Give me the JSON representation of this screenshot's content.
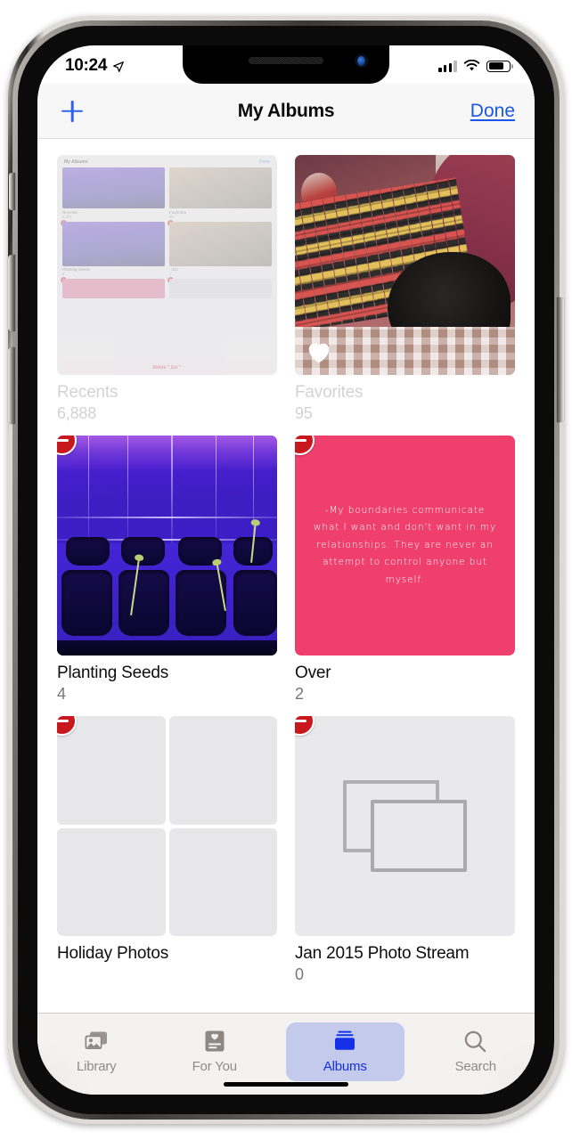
{
  "status_bar": {
    "time": "10:24",
    "location_icon": "location-arrow-icon",
    "signal_icon": "cellular-signal-icon",
    "signal_bars_filled": 3,
    "signal_bars_total": 4,
    "wifi_icon": "wifi-icon",
    "battery_icon": "battery-icon",
    "battery_level_percent": 64
  },
  "navbar": {
    "add_label": "",
    "add_icon": "plus-icon",
    "title": "My Albums",
    "done_label": "Done",
    "accent_color": "#1a57e8"
  },
  "albums": [
    {
      "name": "Recents",
      "count": "6,888",
      "deletable": false,
      "dimmed": true,
      "art": "recursive-screenshot",
      "nested": {
        "title": "My Albums",
        "done_label": "Done",
        "items": [
          {
            "name": "Recents",
            "count": "6,883"
          },
          {
            "name": "Favorites",
            "count": "95"
          },
          {
            "name": "Planting Seeds",
            "count": "4"
          },
          {
            "name": ". Zzz",
            "count": "1"
          }
        ],
        "sheet_label": "Delete \" Zzz \""
      }
    },
    {
      "name": "Favorites",
      "count": "95",
      "deletable": false,
      "dimmed": true,
      "art": "photo-blanket-dog",
      "overlay_icon": "heart-icon"
    },
    {
      "name": "Planting Seeds",
      "count": "4",
      "deletable": true,
      "dimmed": false,
      "art": "photo-uv-seedling-tray"
    },
    {
      "name": "Over",
      "count": "2",
      "deletable": true,
      "dimmed": false,
      "art": "pink-quote-card",
      "quote": "-My boundaries communicate what I want and don't want in my relationships. They are never an attempt to control anyone but myself.",
      "quote_bg_color": "#ef3f6d"
    },
    {
      "name": "Holiday Photos",
      "count": "",
      "deletable": true,
      "dimmed": false,
      "art": "empty-quad-placeholder"
    },
    {
      "name": "Jan 2015 Photo Stream",
      "count": "0",
      "deletable": true,
      "dimmed": false,
      "art": "photo-stream-placeholder-icon"
    }
  ],
  "delete_badge": {
    "icon": "minus-circle-icon",
    "color": "#c8181e"
  },
  "tabbar": {
    "active": "Albums",
    "active_color": "#1330e4",
    "items": [
      {
        "label": "Library",
        "icon": "photos-library-icon"
      },
      {
        "label": "For You",
        "icon": "for-you-heart-card-icon"
      },
      {
        "label": "Albums",
        "icon": "albums-stack-icon"
      },
      {
        "label": "Search",
        "icon": "magnifier-icon"
      }
    ]
  }
}
